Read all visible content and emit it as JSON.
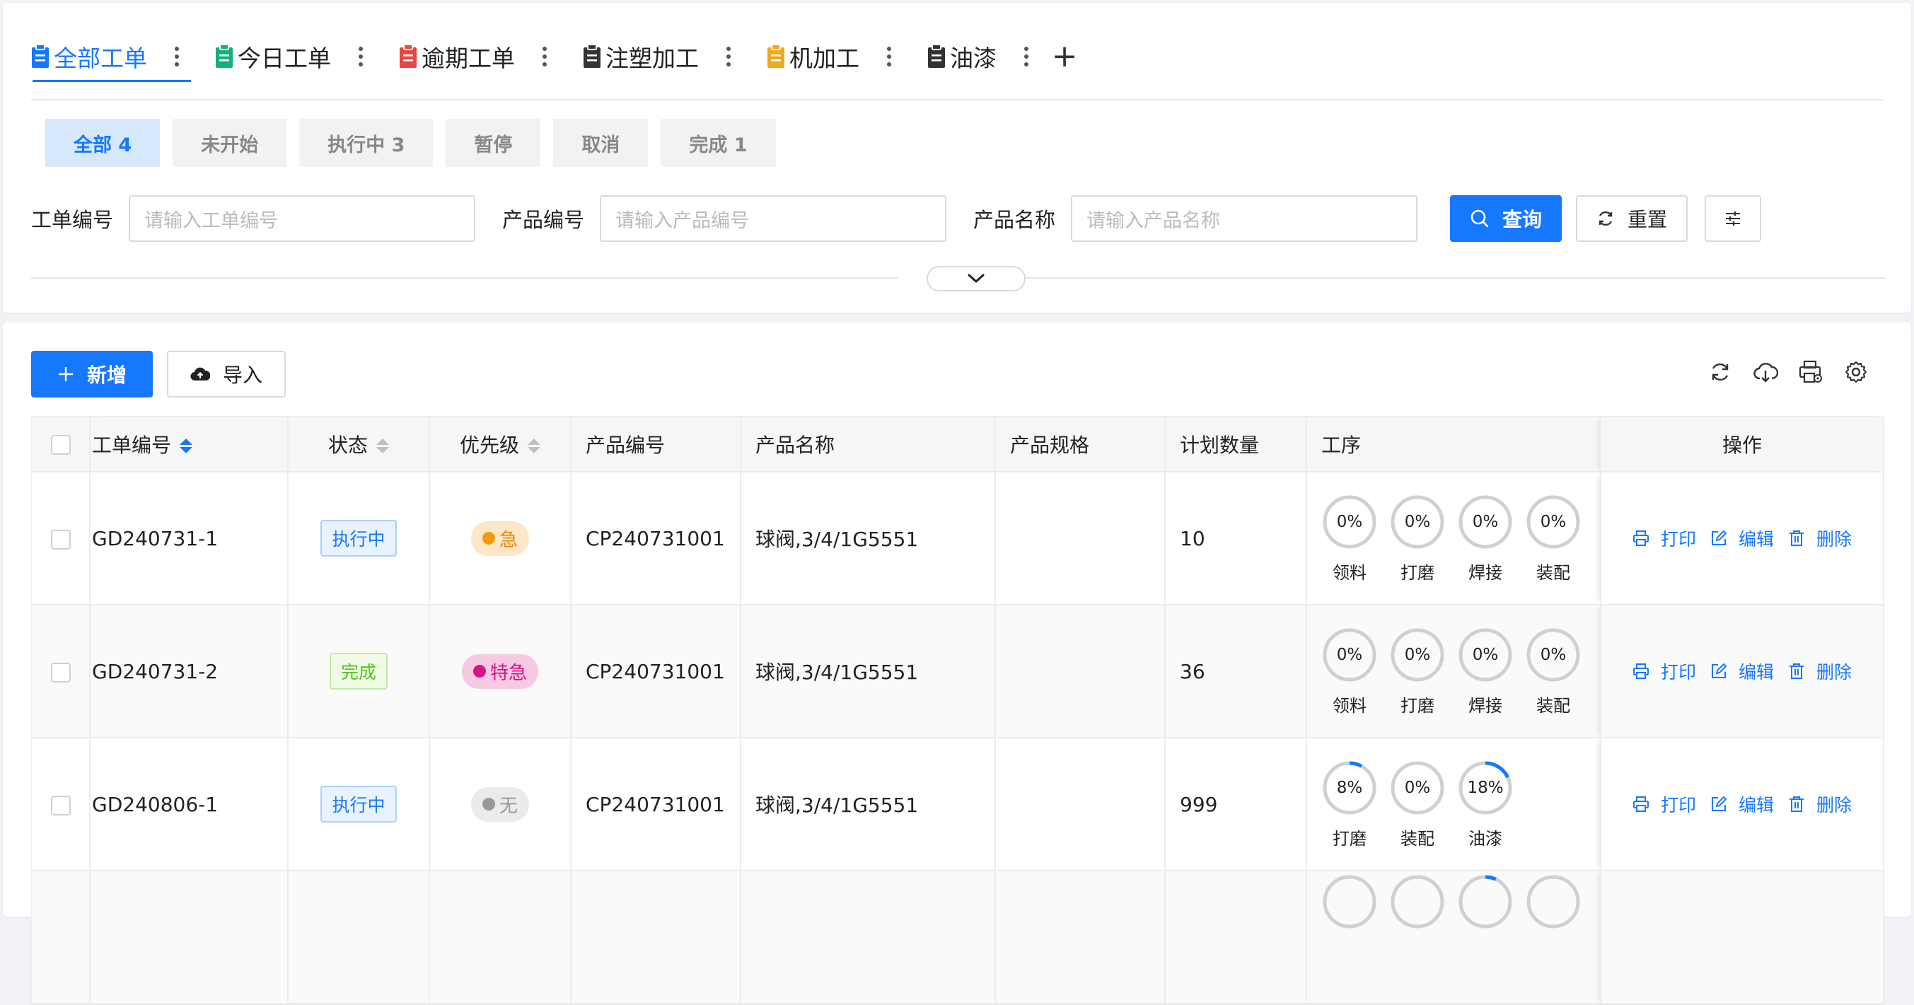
{
  "view_tabs": [
    {
      "label": "全部工单",
      "color": "#1677ff",
      "active": true
    },
    {
      "label": "今日工单",
      "color": "#13b07a"
    },
    {
      "label": "逾期工单",
      "color": "#e8473f"
    },
    {
      "label": "注塑加工",
      "color": "#333333"
    },
    {
      "label": "机加工",
      "color": "#f0a91c"
    },
    {
      "label": "油漆",
      "color": "#333333"
    }
  ],
  "status_filters": [
    {
      "label": "全部 4",
      "active": true
    },
    {
      "label": "未开始"
    },
    {
      "label": "执行中 3"
    },
    {
      "label": "暂停"
    },
    {
      "label": "取消"
    },
    {
      "label": "完成 1"
    }
  ],
  "search": {
    "order_no_label": "工单编号",
    "order_no_placeholder": "请输入工单编号",
    "product_no_label": "产品编号",
    "product_no_placeholder": "请输入产品编号",
    "product_name_label": "产品名称",
    "product_name_placeholder": "请输入产品名称",
    "query_label": "查询",
    "reset_label": "重置"
  },
  "toolbar": {
    "add_label": "新增",
    "import_label": "导入"
  },
  "table": {
    "columns": {
      "order_no": "工单编号",
      "status": "状态",
      "priority": "优先级",
      "product_no": "产品编号",
      "product_name": "产品名称",
      "product_spec": "产品规格",
      "plan_qty": "计划数量",
      "process": "工序",
      "actions": "操作"
    },
    "action_labels": {
      "print": "打印",
      "edit": "编辑",
      "delete": "删除"
    },
    "rows": [
      {
        "order_no": "GD240731-1",
        "status": "执行中",
        "priority": "急",
        "product_no": "CP240731001",
        "product_name": "球阀,3/4/1G5551",
        "product_spec": "",
        "plan_qty": "10",
        "processes": [
          {
            "name": "领料",
            "label": "0%",
            "value": 0
          },
          {
            "name": "打磨",
            "label": "0%",
            "value": 0
          },
          {
            "name": "焊接",
            "label": "0%",
            "value": 0
          },
          {
            "name": "装配",
            "label": "0%",
            "value": 0
          }
        ]
      },
      {
        "order_no": "GD240731-2",
        "status": "完成",
        "priority": "特急",
        "product_no": "CP240731001",
        "product_name": "球阀,3/4/1G5551",
        "product_spec": "",
        "plan_qty": "36",
        "processes": [
          {
            "name": "领料",
            "label": "0%",
            "value": 0
          },
          {
            "name": "打磨",
            "label": "0%",
            "value": 0
          },
          {
            "name": "焊接",
            "label": "0%",
            "value": 0
          },
          {
            "name": "装配",
            "label": "0%",
            "value": 0
          }
        ]
      },
      {
        "order_no": "GD240806-1",
        "status": "执行中",
        "priority": "无",
        "product_no": "CP240731001",
        "product_name": "球阀,3/4/1G5551",
        "product_spec": "",
        "plan_qty": "999",
        "processes": [
          {
            "name": "打磨",
            "label": "8%",
            "value": 8
          },
          {
            "name": "装配",
            "label": "0%",
            "value": 0
          },
          {
            "name": "油漆",
            "label": "18%",
            "value": 18
          }
        ]
      }
    ]
  },
  "colors": {
    "accent": "#1677ff",
    "ring_track": "#d0d0d0"
  }
}
